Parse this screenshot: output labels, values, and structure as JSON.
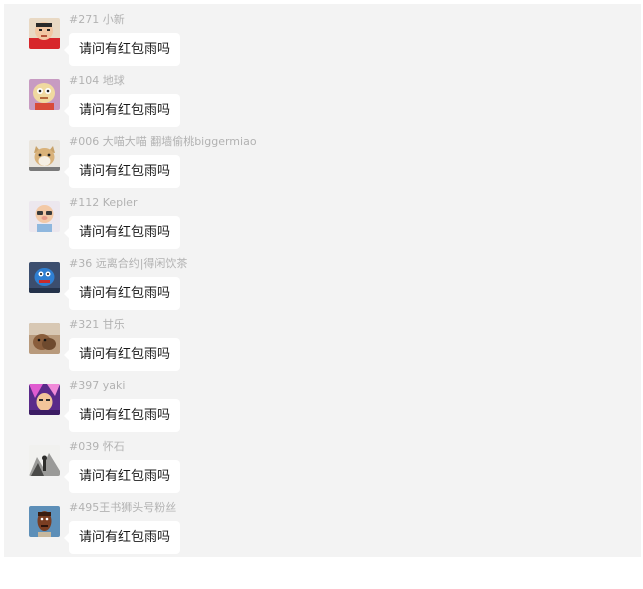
{
  "chat": {
    "messages": [
      {
        "sender": "#271 小新",
        "text": "请问有红包雨吗",
        "avatar_icon": "crayon-shinchan-avatar-icon"
      },
      {
        "sender": "#104 地球",
        "text": "请问有红包雨吗",
        "avatar_icon": "cartoon-baby-avatar-icon"
      },
      {
        "sender": "#006 大喵大喵 翻墙偷桃biggermiao",
        "text": "请问有红包雨吗",
        "avatar_icon": "cat-avatar-icon"
      },
      {
        "sender": "#112 Kepler",
        "text": "请问有红包雨吗",
        "avatar_icon": "cartoon-pig-avatar-icon"
      },
      {
        "sender": "#36 远离合约|得闲饮茶",
        "text": "请问有红包雨吗",
        "avatar_icon": "blue-creature-avatar-icon"
      },
      {
        "sender": "#321 甘乐",
        "text": "请问有红包雨吗",
        "avatar_icon": "dog-photo-avatar-icon"
      },
      {
        "sender": "#397 yaki",
        "text": "请问有红包雨吗",
        "avatar_icon": "anime-hero-avatar-icon"
      },
      {
        "sender": "#039 怀石",
        "text": "请问有红包雨吗",
        "avatar_icon": "ink-landscape-avatar-icon"
      },
      {
        "sender": "#495王书狮头号粉丝",
        "text": "请问有红包雨吗",
        "avatar_icon": "cartoon-face-avatar-icon"
      }
    ]
  },
  "colors": {
    "panel_background": "#f3f3f3",
    "bubble_background": "#ffffff",
    "sender_text": "#b2b2b2",
    "message_text": "#1a1a1a"
  }
}
